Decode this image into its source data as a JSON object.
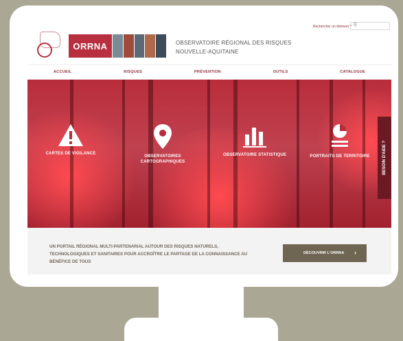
{
  "header": {
    "brand": "ORRNA",
    "org_line1": "OBSERVATOIRE RÉGIONAL DES RISQUES",
    "org_line2": "NOUVELLE-AQUITAINE",
    "search_link": "Rechercher un élément ?",
    "search_value": "Q"
  },
  "nav": {
    "items": [
      "ACCUEIL",
      "RISQUES",
      "PRÉVENTION",
      "OUTILS",
      "CATALOGUE"
    ]
  },
  "hero": {
    "features": [
      {
        "label": "CARTES DE VIGILANCE",
        "icon": "warning-icon"
      },
      {
        "label": "OBSERVATOIRES CARTOGRAPHIQUES",
        "icon": "map-pin-icon"
      },
      {
        "label": "OBSERVATOIRE STATISTIQUE",
        "icon": "bar-chart-icon"
      },
      {
        "label": "PORTRAITS DE TERRITOIRE",
        "icon": "pie-chart-icon"
      }
    ],
    "side_tab": "BESOIN D'AIDE ?"
  },
  "band": {
    "tagline": "UN PORTAIL RÉGIONAL MULTI-PARTENARIAL AUTOUR DES RISQUES NATURELS, TECHNOLOGIQUES ET SANITAIRES POUR ACCROÎTRE LE PARTAGE DE LA CONNAISSANCE AU BÉNÉFICE DE TOUS",
    "cta_label": "DÉCOUVRIR L'ORRNA",
    "cta_arrow": "›"
  },
  "colors": {
    "brand_red": "#b8303f",
    "cta_bg": "#6e6552",
    "page_bg": "#aaa795"
  }
}
